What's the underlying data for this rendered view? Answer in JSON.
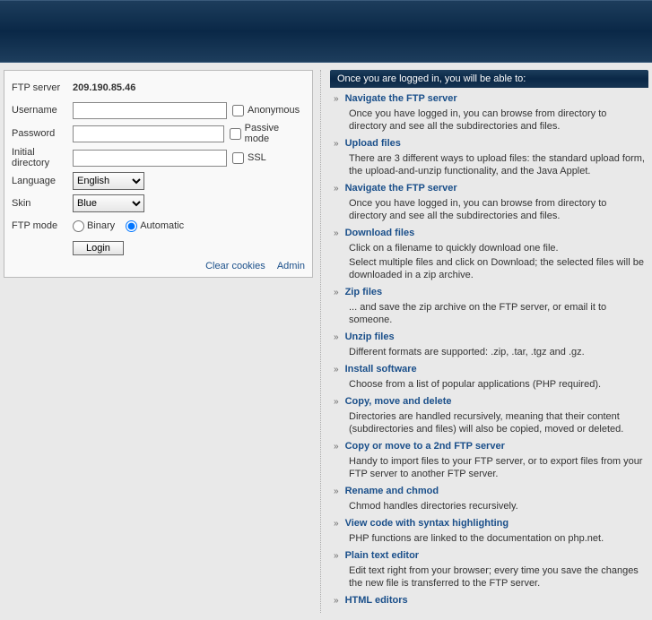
{
  "form": {
    "labels": {
      "ftp_server": "FTP server",
      "username": "Username",
      "password": "Password",
      "initial_dir": "Initial directory",
      "language": "Language",
      "skin": "Skin",
      "ftp_mode": "FTP mode"
    },
    "server_value": "209.190.85.46",
    "checkboxes": {
      "anonymous": "Anonymous",
      "passive": "Passive mode",
      "ssl": "SSL"
    },
    "selects": {
      "language": "English",
      "skin": "Blue"
    },
    "radios": {
      "binary": "Binary",
      "automatic": "Automatic"
    },
    "login_button": "Login",
    "links": {
      "clear_cookies": "Clear cookies",
      "admin": "Admin"
    }
  },
  "info": {
    "header": "Once you are logged in, you will be able to:",
    "features": [
      {
        "title": "Navigate the FTP server",
        "desc": "Once you have logged in, you can browse from directory to directory and see all the subdirectories and files."
      },
      {
        "title": "Upload files",
        "desc": "There are 3 different ways to upload files: the standard upload form, the upload-and-unzip functionality, and the Java Applet."
      },
      {
        "title": "Navigate the FTP server",
        "desc": "Once you have logged in, you can browse from directory to directory and see all the subdirectories and files."
      },
      {
        "title": "Download files",
        "desc": "Click on a filename to quickly download one file.\nSelect multiple files and click on Download; the selected files will be downloaded in a zip archive."
      },
      {
        "title": "Zip files",
        "desc": "... and save the zip archive on the FTP server, or email it to someone."
      },
      {
        "title": "Unzip files",
        "desc": "Different formats are supported: .zip, .tar, .tgz and .gz."
      },
      {
        "title": "Install software",
        "desc": "Choose from a list of popular applications (PHP required)."
      },
      {
        "title": "Copy, move and delete",
        "desc": "Directories are handled recursively, meaning that their content (subdirectories and files) will also be copied, moved or deleted."
      },
      {
        "title": "Copy or move to a 2nd FTP server",
        "desc": "Handy to import files to your FTP server, or to export files from your FTP server to another FTP server."
      },
      {
        "title": "Rename and chmod",
        "desc": "Chmod handles directories recursively."
      },
      {
        "title": "View code with syntax highlighting",
        "desc": "PHP functions are linked to the documentation on php.net."
      },
      {
        "title": "Plain text editor",
        "desc": "Edit text right from your browser; every time you save the changes the new file is transferred to the FTP server."
      },
      {
        "title": "HTML editors",
        "desc": ""
      }
    ]
  }
}
